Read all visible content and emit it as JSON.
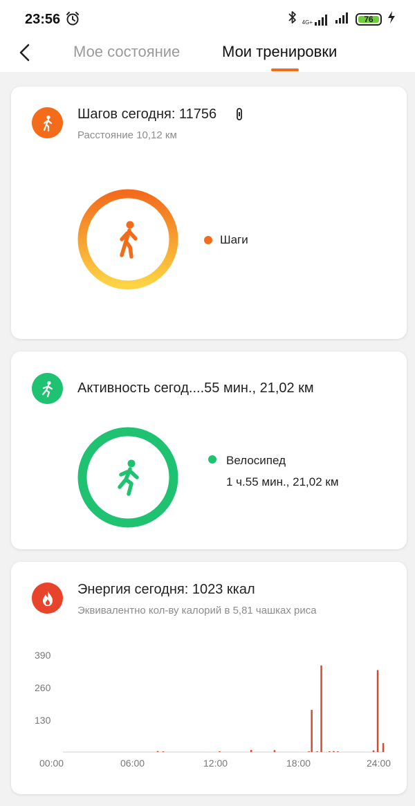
{
  "status_bar": {
    "time": "23:56",
    "network": "4G+",
    "battery": "76",
    "icons": [
      "alarm-icon",
      "bluetooth-icon",
      "signal-icon",
      "signal-icon",
      "battery-icon",
      "charging-icon"
    ]
  },
  "header": {
    "tabs": [
      {
        "label": "Мое состояние",
        "active": false
      },
      {
        "label": "Мои тренировки",
        "active": true
      }
    ],
    "accent_color": "#f36c1c"
  },
  "steps_card": {
    "title": "Шагов сегодня: 11756",
    "subtitle": "Расстояние 10,12 км",
    "legend": "Шаги",
    "color": "#f36c1c",
    "icons": [
      "walking-icon",
      "band-icon"
    ]
  },
  "activity_card": {
    "title": "Активность сегод....55 мин., 21,02 км",
    "legend_name": "Велосипед",
    "legend_value": "1 ч.55 мин., 21,02 км",
    "color": "#1ec271",
    "icons": [
      "running-icon"
    ]
  },
  "energy_card": {
    "title": "Энергия сегодня: 1023 ккал",
    "subtitle": "Эквивалентно кол-ву калорий в 5,81 чашках риса",
    "color": "#e8442b",
    "icons": [
      "flame-icon"
    ]
  },
  "chart_data": {
    "type": "bar",
    "title": "",
    "xlabel": "",
    "ylabel": "",
    "y_ticks": [
      "390",
      "260",
      "130"
    ],
    "x_ticks": [
      "00:00",
      "06:00",
      "12:00",
      "18:00",
      "24:00"
    ],
    "ylim": [
      0,
      390
    ],
    "xlim": [
      0,
      24
    ],
    "grid": false,
    "x": [
      7.6,
      8.0,
      12.1,
      14.4,
      16.1,
      18.6,
      18.8,
      19.2,
      19.5,
      20.1,
      20.4,
      20.7,
      23.3,
      23.6,
      24.0
    ],
    "values": [
      4,
      3,
      3,
      9,
      8,
      3,
      180,
      3,
      370,
      3,
      4,
      3,
      7,
      350,
      38
    ],
    "color": "#d84a2e"
  }
}
